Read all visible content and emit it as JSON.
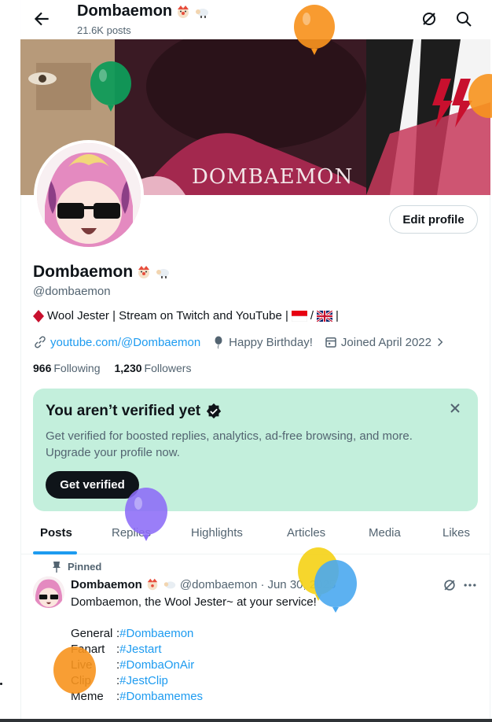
{
  "header": {
    "back_icon": "arrow-left-icon",
    "name": "Dombaemon",
    "post_count": "21.6K posts",
    "icons": [
      "grok-icon",
      "search-icon"
    ]
  },
  "banner": {
    "text": "DOMBAEMON"
  },
  "profile": {
    "edit_label": "Edit profile",
    "name": "Dombaemon",
    "handle": "@dombaemon",
    "bio": "Wool Jester | Stream on Twitch and YouTube | ",
    "bio_end": "/",
    "bio_tail": "|",
    "link": "youtube.com/@Dombaemon",
    "birthday": "Happy Birthday!",
    "joined": "Joined April 2022",
    "following_count": "966",
    "following_label": "Following",
    "followers_count": "1,230",
    "followers_label": "Followers"
  },
  "verify_card": {
    "title": "You aren’t verified yet",
    "text": "Get verified for boosted replies, analytics, ad-free browsing, and more. Upgrade your profile now.",
    "button": "Get verified",
    "bg": "#c3efdc"
  },
  "tabs": [
    {
      "label": "Posts",
      "active": true
    },
    {
      "label": "Replies"
    },
    {
      "label": "Highlights"
    },
    {
      "label": "Articles"
    },
    {
      "label": "Media"
    },
    {
      "label": "Likes"
    }
  ],
  "post": {
    "pinned": "Pinned",
    "name": "Dombaemon",
    "handle": "@dombaemon",
    "sep": "·",
    "date": "Jun 30, 2025",
    "intro": "Dombaemon, the Wool Jester~ at your service!",
    "lines": [
      {
        "label": "General",
        "sep": ": ",
        "tag": "#Dombaemon"
      },
      {
        "label": "Fanart",
        "sep": ": ",
        "tag": "#Jestart"
      },
      {
        "label": "Live",
        "sep": ": ",
        "tag": "#DombaOnAir"
      },
      {
        "label": "Clip",
        "sep": ": ",
        "tag": "#JestClip"
      },
      {
        "label": "Meme",
        "sep": ": ",
        "tag": "#Dombamemes"
      }
    ]
  },
  "colors": {
    "accent": "#1d9bf0",
    "text": "#0f1419",
    "muted": "#536471"
  }
}
